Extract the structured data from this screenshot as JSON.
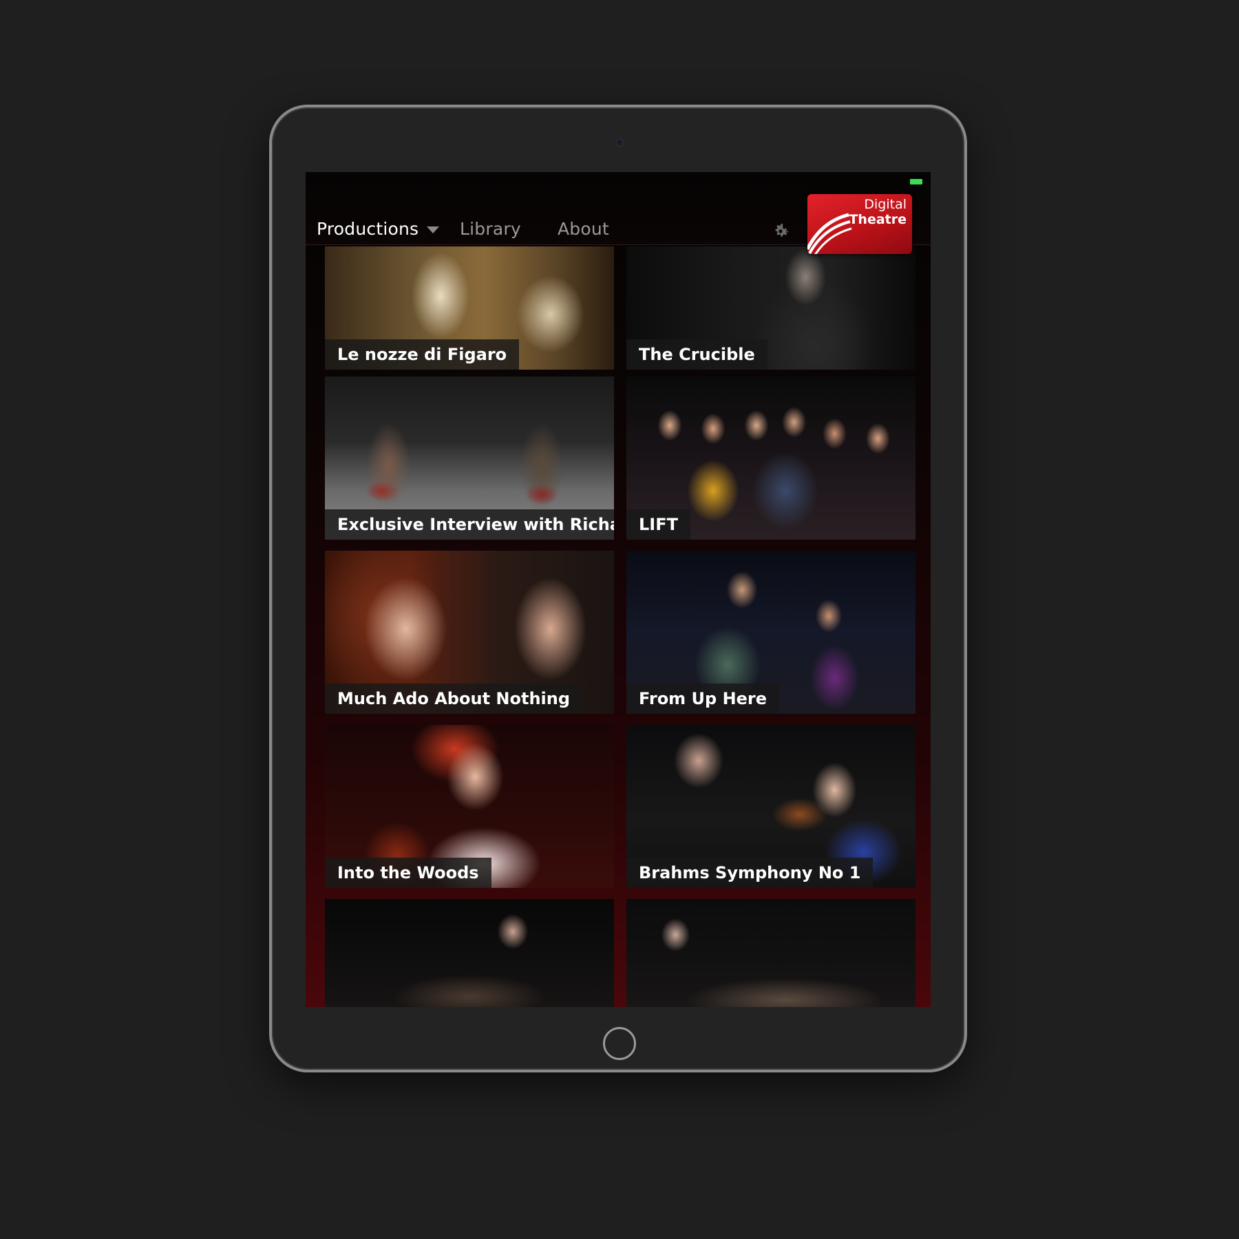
{
  "screen": {
    "nav": {
      "productions_label": "Productions",
      "library_label": "Library",
      "about_label": "About"
    },
    "logo": {
      "line1": "Digital",
      "line2": "Theatre"
    },
    "tiles": [
      {
        "title": "Le nozze di Figaro"
      },
      {
        "title": "The Crucible"
      },
      {
        "title": "Exclusive Interview with Richard Arm"
      },
      {
        "title": "LIFT"
      },
      {
        "title": "Much Ado About Nothing"
      },
      {
        "title": "From Up Here"
      },
      {
        "title": "Into the Woods"
      },
      {
        "title": "Brahms Symphony No 1"
      },
      {
        "title": ""
      },
      {
        "title": ""
      }
    ]
  },
  "colors": {
    "accent": "#d41f27",
    "battery": "#3ddc55",
    "background": "#1f1f1f"
  },
  "icons": [
    "settings-gear-icon",
    "dropdown-chevron-icon",
    "digital-theatre-logo"
  ]
}
